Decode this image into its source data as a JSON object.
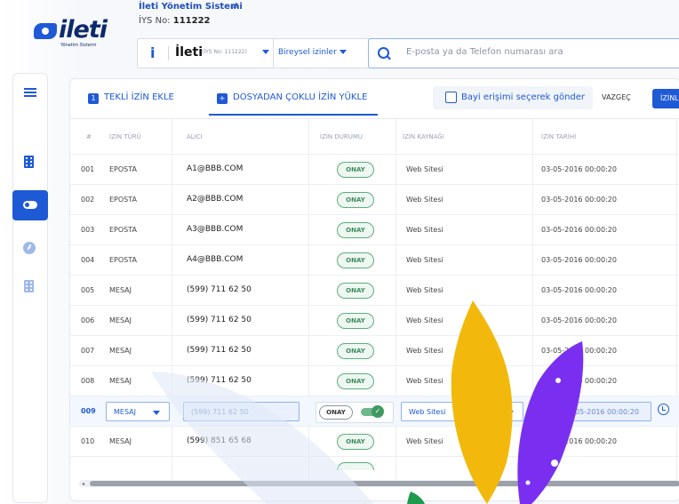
{
  "header": {
    "system_title": "İleti Yönetim Sistemi",
    "ys_label": "İYS No:",
    "ys_number": "111222",
    "logo_text": "ileti",
    "logo_subtitle": "Yönetim Sistemi",
    "brand": {
      "icon_letter": "i",
      "name": "İleti",
      "ys_hint": "(İYS No: 111222)",
      "permission_type": "Bireysel izinler"
    },
    "search": {
      "placeholder": "E-posta ya da Telefon numarası ara",
      "value": ""
    }
  },
  "sidebar": {
    "items": [
      {
        "name": "menu",
        "icon": "menu-icon"
      },
      {
        "name": "building",
        "icon": "building-icon"
      },
      {
        "name": "consents",
        "icon": "toggle-icon",
        "active": true
      },
      {
        "name": "dashboard",
        "icon": "gauge-icon"
      },
      {
        "name": "companies",
        "icon": "building-icon"
      }
    ]
  },
  "toolbar": {
    "single_num": "1",
    "single_label": "TEKLİ İZİN EKLE",
    "bulk_icon": "+",
    "bulk_label": "DOSYADAN ÇOKLU İZİN YÜKLE",
    "dealer_checkbox_label": "Bayi erişimi seçerek gönder",
    "cancel_label": "VAZGEÇ",
    "submit_label": "İZİNL"
  },
  "table": {
    "columns": [
      "#",
      "İZİN TÜRÜ",
      "ALICI",
      "İZİN DURUMU",
      "İZİN KAYNAĞI",
      "İZİN TARİHİ"
    ],
    "rows": [
      {
        "no": "001",
        "type": "EPOSTA",
        "recipient": "A1@BBB.COM",
        "status": "ONAY",
        "source": "Web Sitesi",
        "date": "03-05-2016 00:00:20"
      },
      {
        "no": "002",
        "type": "EPOSTA",
        "recipient": "A2@BBB.COM",
        "status": "ONAY",
        "source": "Web Sitesi",
        "date": "03-05-2016 00:00:20"
      },
      {
        "no": "003",
        "type": "EPOSTA",
        "recipient": "A3@BBB.COM",
        "status": "ONAY",
        "source": "Web Sitesi",
        "date": "03-05-2016 00:00:20"
      },
      {
        "no": "004",
        "type": "EPOSTA",
        "recipient": "A4@BBB.COM",
        "status": "ONAY",
        "source": "Web Sitesi",
        "date": "03-05-2016 00:00:20"
      },
      {
        "no": "005",
        "type": "MESAJ",
        "recipient": "(599) 711 62 50",
        "status": "ONAY",
        "source": "Web Sitesi",
        "date": "03-05-2016 00:00:20"
      },
      {
        "no": "006",
        "type": "MESAJ",
        "recipient": "(599) 711 62 50",
        "status": "ONAY",
        "source": "Web Sitesi",
        "date": "03-05-2016 00:00:20"
      },
      {
        "no": "007",
        "type": "MESAJ",
        "recipient": "(599) 711 62 50",
        "status": "ONAY",
        "source": "Web Sitesi",
        "date": "03-05-2016 00:00:20"
      },
      {
        "no": "008",
        "type": "MESAJ",
        "recipient": "(599) 711 62 50",
        "status": "ONAY",
        "source": "Web Sitesi",
        "date": "03-05-2016 00:00:20"
      }
    ],
    "edit_row": {
      "no": "009",
      "type": "MESAJ",
      "recipient": "(599) 711 62 50",
      "status": "ONAY",
      "source": "Web Sitesi",
      "date": "03-05-2016 00:00:20"
    },
    "rows_after": [
      {
        "no": "010",
        "type": "MESAJ",
        "recipient": "(599) 851 65 68",
        "status": "ONAY",
        "source": "Web Sitesi",
        "date": "03-05-2016 00:00:20"
      }
    ]
  },
  "colors": {
    "accent": "#1e5ad6",
    "approved": "#3f8d5f",
    "leaf_yellow": "#f2b90c",
    "leaf_purple": "#7a2ff0",
    "leaf_green": "#1f9a4d"
  }
}
